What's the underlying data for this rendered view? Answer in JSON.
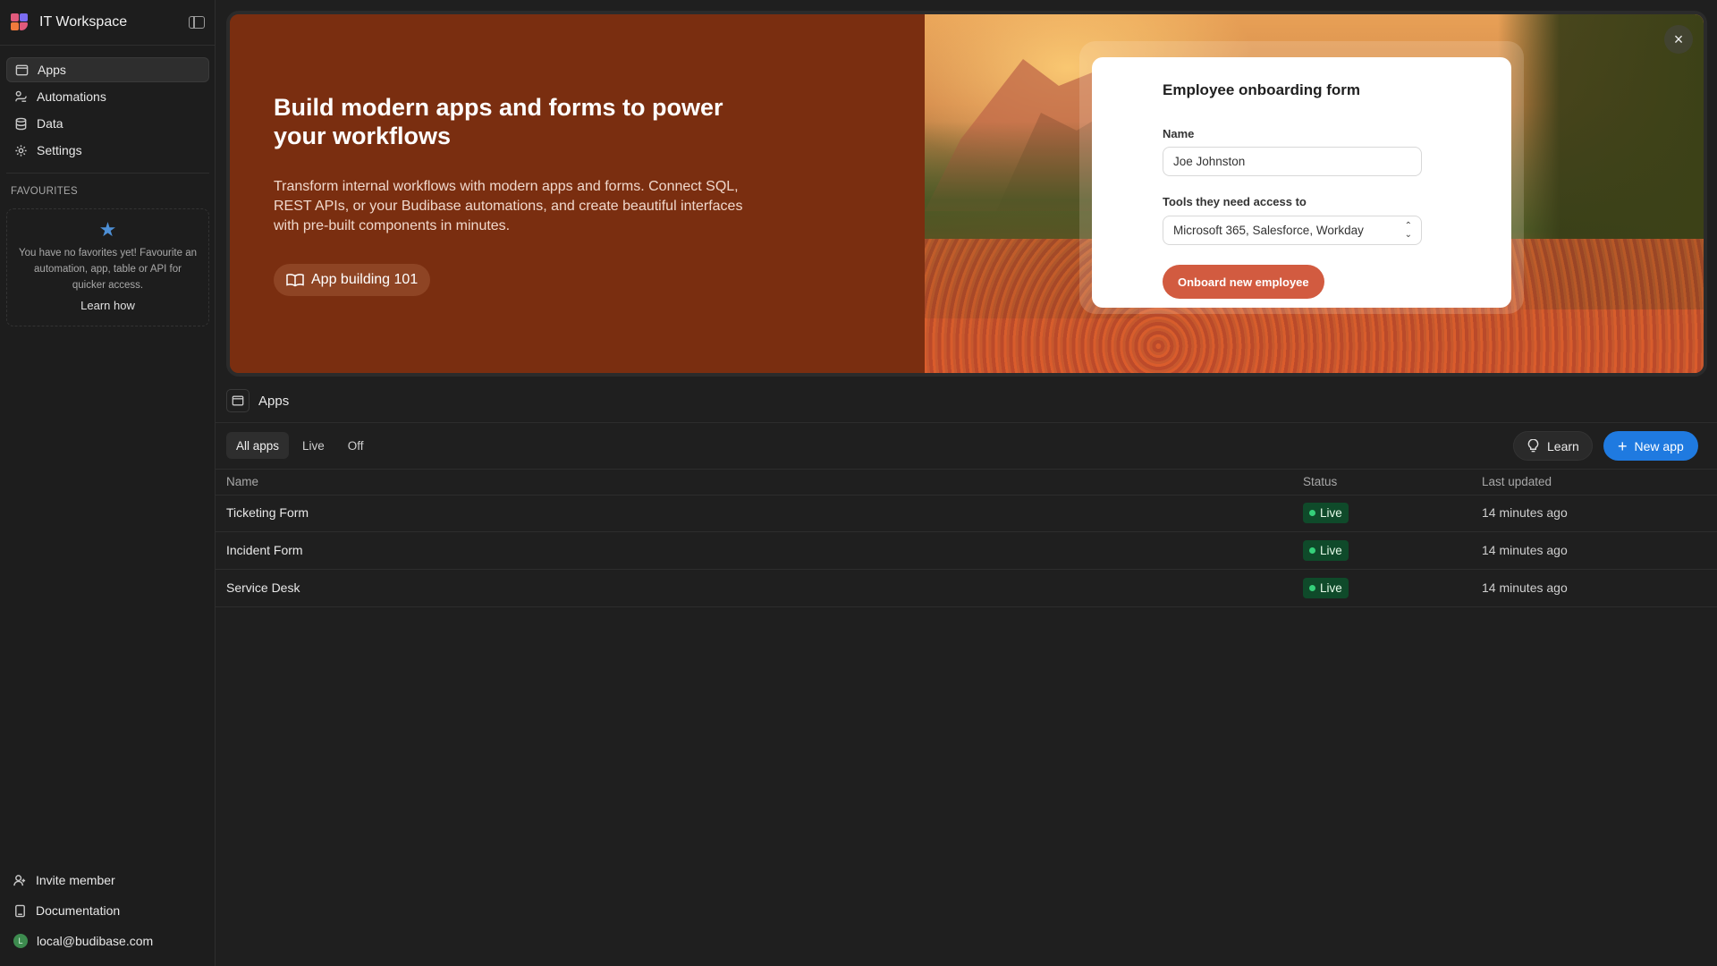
{
  "workspace": {
    "title": "IT Workspace"
  },
  "sidebar": {
    "nav": [
      {
        "label": "Apps",
        "icon": "window-icon",
        "active": true
      },
      {
        "label": "Automations",
        "icon": "automation-icon",
        "active": false
      },
      {
        "label": "Data",
        "icon": "database-icon",
        "active": false
      },
      {
        "label": "Settings",
        "icon": "gear-icon",
        "active": false
      }
    ],
    "favourites": {
      "label": "FAVOURITES",
      "empty_text": "You have no favorites yet! Favourite an automation, app, table or API for quicker access.",
      "learn_link": "Learn how"
    },
    "bottom": {
      "invite": "Invite member",
      "docs": "Documentation",
      "user": "local@budibase.com",
      "avatar_letter": "L"
    }
  },
  "banner": {
    "title": "Build modern apps and forms to power your workflows",
    "description": "Transform internal workflows with modern apps and forms. Connect SQL, REST APIs, or your Budibase automations, and create beautiful interfaces with pre-built components in minutes.",
    "button": "App building 101",
    "close": "×",
    "form": {
      "title": "Employee onboarding form",
      "name_label": "Name",
      "name_value": "Joe Johnston",
      "tools_label": "Tools they need access to",
      "tools_value": "Microsoft 365, Salesforce, Workday",
      "submit": "Onboard new employee"
    }
  },
  "apps": {
    "title": "Apps",
    "filters": [
      "All apps",
      "Live",
      "Off"
    ],
    "active_filter": "All apps",
    "learn_label": "Learn",
    "new_label": "New app",
    "columns": {
      "name": "Name",
      "status": "Status",
      "updated": "Last updated"
    },
    "rows": [
      {
        "name": "Ticketing Form",
        "status": "Live",
        "updated": "14 minutes ago"
      },
      {
        "name": "Incident Form",
        "status": "Live",
        "updated": "14 minutes ago"
      },
      {
        "name": "Service Desk",
        "status": "Live",
        "updated": "14 minutes ago"
      }
    ]
  },
  "colors": {
    "accent_blue": "#1f7ae0",
    "banner_brown": "#7a2e10",
    "form_button": "#d25b40",
    "live_badge": "#0f4a2a"
  }
}
